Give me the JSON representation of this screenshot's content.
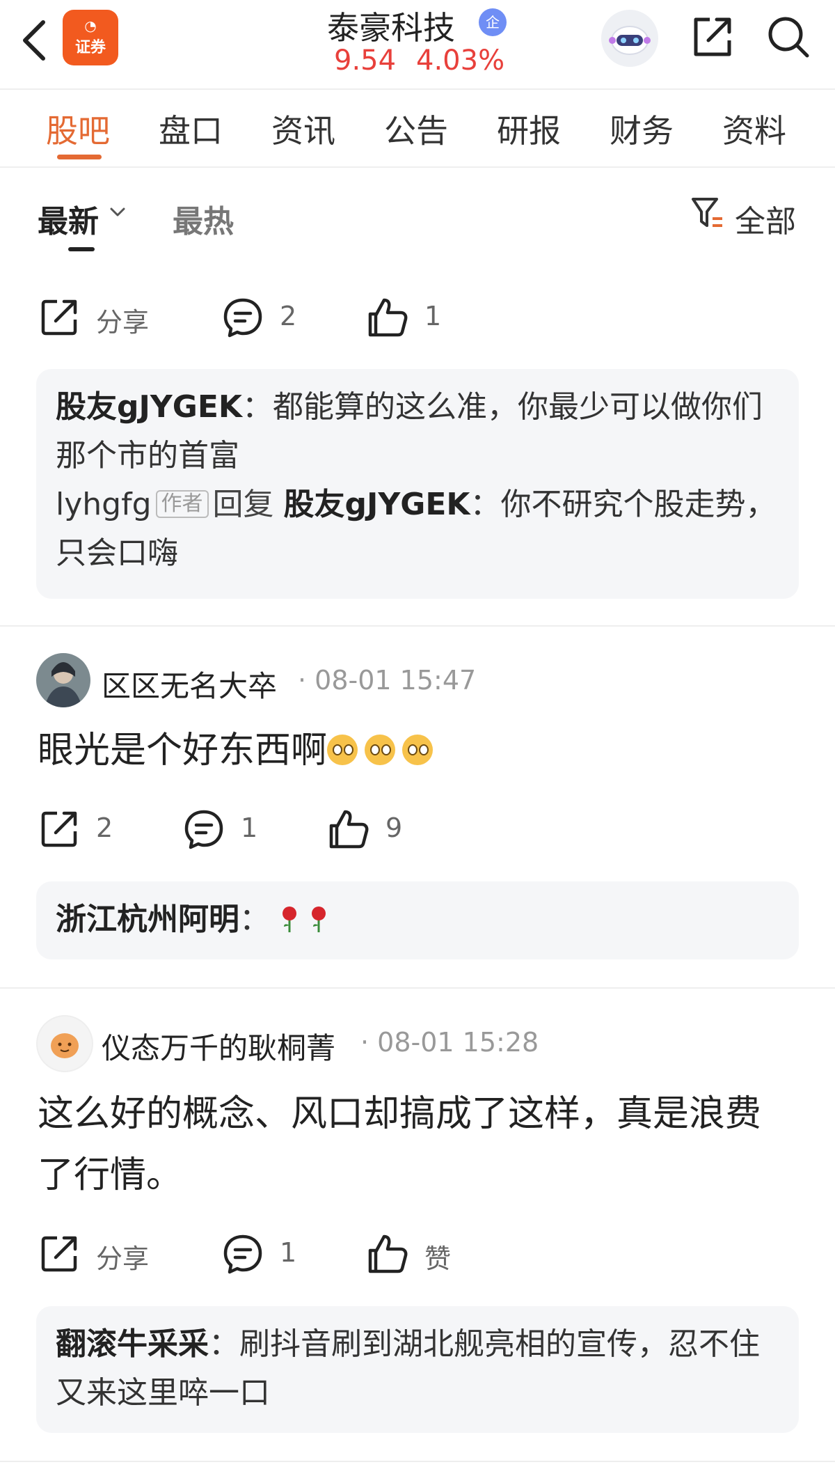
{
  "header": {
    "app_logo_text": "证券",
    "stock_name": "泰豪科技",
    "badge": "企",
    "price": "9.54",
    "change": "4.03%"
  },
  "tabs": [
    {
      "label": "股吧",
      "active": true
    },
    {
      "label": "盘口"
    },
    {
      "label": "资讯"
    },
    {
      "label": "公告"
    },
    {
      "label": "研报"
    },
    {
      "label": "财务"
    },
    {
      "label": "资料"
    }
  ],
  "sort": {
    "latest": "最新",
    "hot": "最热",
    "filter": "全部"
  },
  "colors": {
    "accent": "#e46a33",
    "price": "#e8403b"
  },
  "posts": [
    {
      "actions": {
        "share": "分享",
        "comments": "2",
        "likes": "1"
      },
      "replies": [
        {
          "user": "股友gJYGEK",
          "text": "：都能算的这么准，你最少可以做你们那个市的首富"
        },
        {
          "user": "lyhgfg",
          "tag": "作者",
          "reply_word": "回复",
          "target": "股友gJYGEK",
          "text": "：你不研究个股走势，只会口嗨"
        }
      ]
    },
    {
      "user": "区区无名大卒",
      "time": "08-01 15:47",
      "body": "眼光是个好东西啊",
      "emoji_icon": "sweat-face-icon",
      "actions": {
        "share": "2",
        "comments": "1",
        "likes": "9"
      },
      "replies": [
        {
          "user": "浙江杭州阿明",
          "text": "：",
          "icon": "rose-icon"
        }
      ]
    },
    {
      "user": "仪态万千的耿桐菁",
      "time": "08-01 15:28",
      "body": "这么好的概念、风口却搞成了这样，真是浪费了行情。",
      "actions": {
        "share": "分享",
        "comments": "1",
        "likes": "赞"
      },
      "replies": [
        {
          "user": "翻滚牛采采",
          "text": "：刷抖音刷到湖北舰亮相的宣传，忍不住又来这里啐一口"
        }
      ]
    }
  ]
}
